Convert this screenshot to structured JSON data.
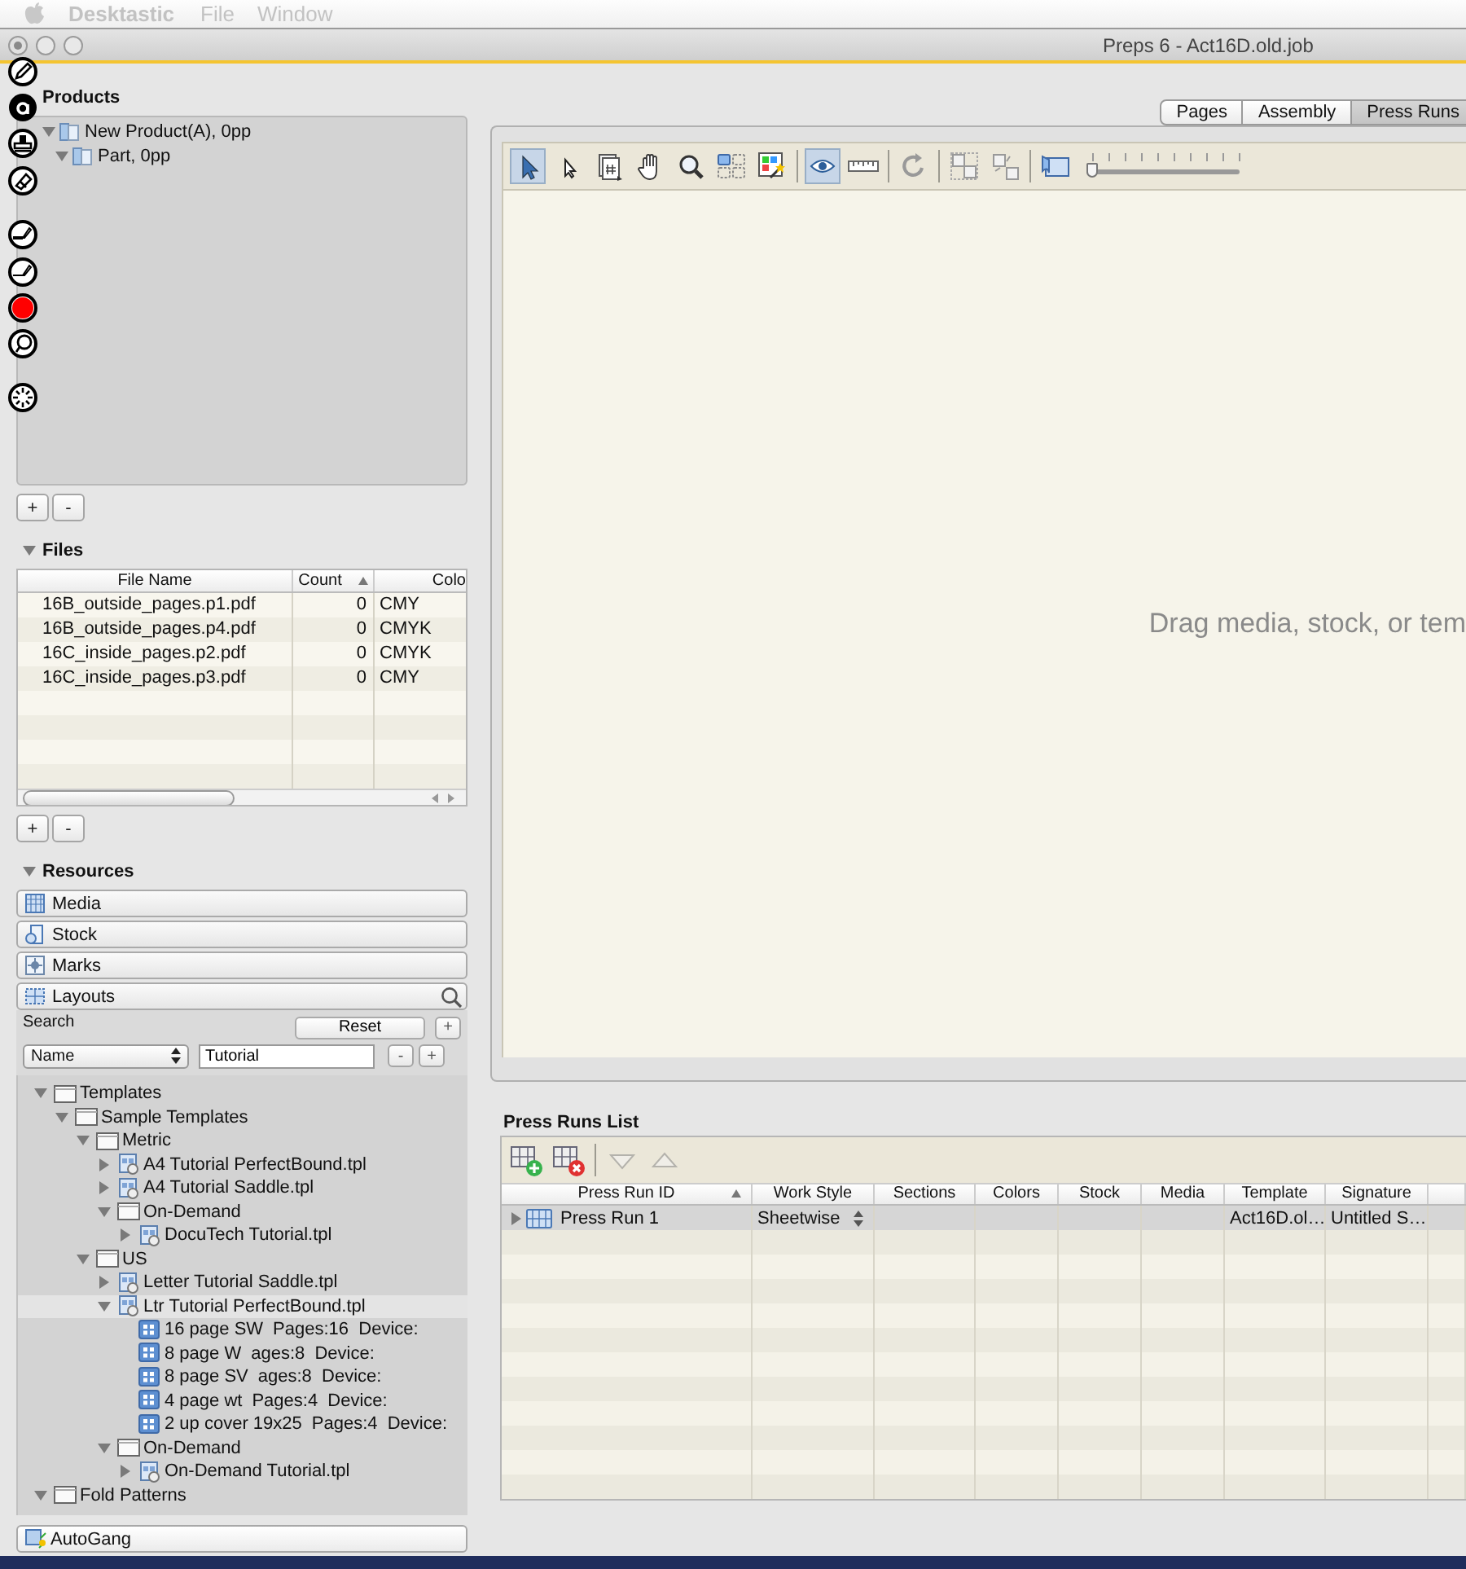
{
  "menubar": {
    "app": "Desktastic",
    "menus": [
      "File",
      "Window"
    ]
  },
  "window": {
    "title": "Preps 6 - Act16D.old.job"
  },
  "products": {
    "title": "Products",
    "buttons": [
      "+",
      "-"
    ],
    "tree": [
      {
        "label": "New Product(A), 0pp",
        "expanded": true,
        "children": [
          {
            "label": "Part, 0pp",
            "expanded": true
          }
        ]
      }
    ]
  },
  "files": {
    "title": "Files",
    "expanded": true,
    "buttons": [
      "+",
      "-"
    ],
    "columns": [
      {
        "label": "File Name",
        "sorted": false
      },
      {
        "label": "Count",
        "sorted": true
      },
      {
        "label": "Colo",
        "sorted": false
      }
    ],
    "rows": [
      [
        "16B_outside_pages.p1.pdf",
        "0",
        "CMY"
      ],
      [
        "16B_outside_pages.p4.pdf",
        "0",
        "CMYK"
      ],
      [
        "16C_inside_pages.p2.pdf",
        "0",
        "CMYK"
      ],
      [
        "16C_inside_pages.p3.pdf",
        "0",
        "CMY"
      ]
    ]
  },
  "resources": {
    "title": "Resources",
    "expanded": true,
    "sections": [
      {
        "label": "Media",
        "kind": "media"
      },
      {
        "label": "Stock",
        "kind": "stock"
      },
      {
        "label": "Marks",
        "kind": "marks"
      },
      {
        "label": "Layouts",
        "kind": "layouts"
      }
    ],
    "search": {
      "label": "Search",
      "reset": "Reset",
      "add": "+",
      "field": "Name",
      "value": "Tutorial",
      "row_buttons": [
        "-",
        "+"
      ]
    },
    "tree": [
      {
        "label": "Templates",
        "kind": "folder",
        "expanded": true,
        "selected": false,
        "children": [
          {
            "label": "Sample Templates",
            "kind": "folder",
            "expanded": true,
            "selected": false,
            "children": [
              {
                "label": "Metric",
                "kind": "folder",
                "expanded": true,
                "selected": false,
                "children": [
                  {
                    "label": "A4 Tutorial PerfectBound.tpl",
                    "kind": "template",
                    "expanded": false,
                    "selected": false
                  },
                  {
                    "label": "A4 Tutorial Saddle.tpl",
                    "kind": "template",
                    "expanded": false,
                    "selected": false
                  },
                  {
                    "label": "On-Demand",
                    "kind": "folder",
                    "expanded": true,
                    "selected": false,
                    "children": [
                      {
                        "label": "DocuTech Tutorial.tpl",
                        "kind": "template",
                        "expanded": false,
                        "selected": false
                      }
                    ]
                  }
                ]
              },
              {
                "label": "US",
                "kind": "folder",
                "expanded": true,
                "selected": false,
                "children": [
                  {
                    "label": "Letter Tutorial Saddle.tpl",
                    "kind": "template",
                    "expanded": false,
                    "selected": false
                  },
                  {
                    "label": "Ltr Tutorial PerfectBound.tpl",
                    "kind": "template",
                    "expanded": true,
                    "selected": true,
                    "children": [
                      {
                        "label": "16 page SW",
                        "detail": "Pages:16  Device:",
                        "kind": "layout",
                        "selected": false
                      },
                      {
                        "label": "8 page W",
                        "detail": "ages:8  Device:",
                        "kind": "layout",
                        "selected": false
                      },
                      {
                        "label": "8 page SV",
                        "detail": "ages:8  Device:",
                        "kind": "layout",
                        "selected": false
                      },
                      {
                        "label": "4 page wt",
                        "detail": "Pages:4  Device:",
                        "kind": "layout",
                        "selected": false
                      },
                      {
                        "label": "2 up cover 19x25",
                        "detail": "Pages:4  Device:",
                        "kind": "layout",
                        "selected": false
                      }
                    ]
                  },
                  {
                    "label": "On-Demand",
                    "kind": "folder",
                    "expanded": true,
                    "selected": false,
                    "children": [
                      {
                        "label": "On-Demand Tutorial.tpl",
                        "kind": "template",
                        "expanded": false,
                        "selected": false
                      }
                    ]
                  }
                ]
              }
            ]
          }
        ]
      },
      {
        "label": "Fold Patterns",
        "kind": "folder",
        "expanded": true,
        "selected": false
      }
    ],
    "autogang": "AutoGang"
  },
  "workspace": {
    "tabs": [
      {
        "label": "Pages",
        "selected": false
      },
      {
        "label": "Assembly",
        "selected": false
      },
      {
        "label": "Press Runs",
        "selected": true
      }
    ],
    "tools": [
      {
        "kind": "pointer",
        "on": true
      },
      {
        "kind": "arrow",
        "on": false
      },
      {
        "kind": "page-number",
        "on": false
      },
      {
        "kind": "hand",
        "on": false
      },
      {
        "kind": "magnifier",
        "on": false
      },
      {
        "kind": "grid",
        "on": false
      },
      {
        "kind": "magic",
        "on": false
      },
      {
        "kind": "separator"
      },
      {
        "kind": "eye",
        "on": true
      },
      {
        "kind": "ruler",
        "on": false
      },
      {
        "kind": "separator"
      },
      {
        "kind": "rotate",
        "on": false
      },
      {
        "kind": "separator"
      },
      {
        "kind": "split",
        "on": false
      },
      {
        "kind": "merge",
        "on": false
      },
      {
        "kind": "separator"
      },
      {
        "kind": "flip",
        "on": false
      }
    ],
    "zoom": {
      "level": 0
    },
    "hint": "Drag media, stock, or tem"
  },
  "press_runs": {
    "title": "Press Runs List",
    "tools": [
      {
        "kind": "add",
        "disabled": false
      },
      {
        "kind": "delete",
        "disabled": false
      },
      {
        "kind": "separator"
      },
      {
        "kind": "down",
        "disabled": true
      },
      {
        "kind": "up",
        "disabled": true
      }
    ],
    "columns": [
      {
        "label": "Press Run ID",
        "sorted": true
      },
      {
        "label": "Work Style",
        "sorted": false
      },
      {
        "label": "Sections",
        "sorted": false
      },
      {
        "label": "Colors",
        "sorted": false
      },
      {
        "label": "Stock",
        "sorted": false
      },
      {
        "label": "Media",
        "sorted": false
      },
      {
        "label": "Template",
        "sorted": false
      },
      {
        "label": "Signature",
        "sorted": false
      }
    ],
    "rows": [
      {
        "id": "Press Run 1",
        "work_style": "Sheetwise",
        "template": "Act16D.ol…",
        "signature": "Untitled S…",
        "selected": true,
        "expanded": false
      }
    ]
  }
}
